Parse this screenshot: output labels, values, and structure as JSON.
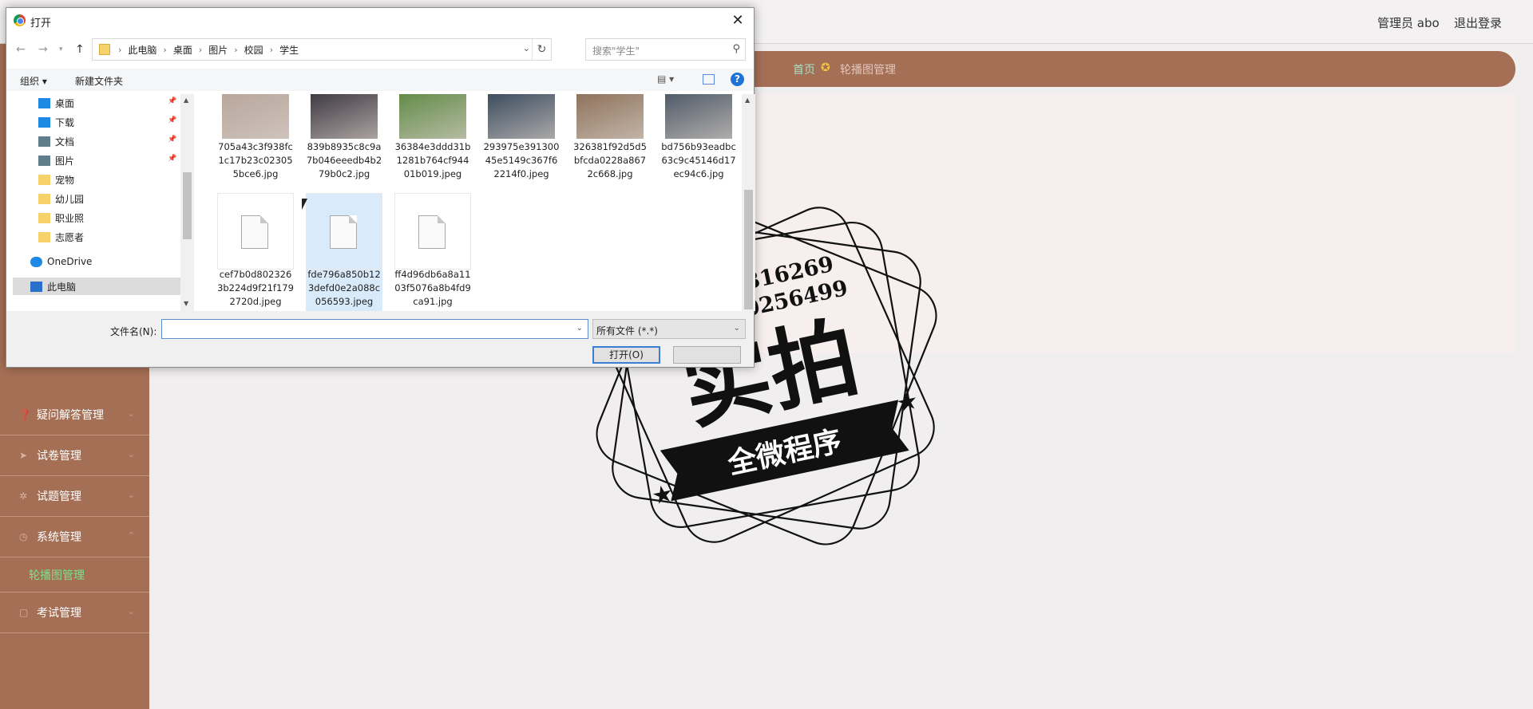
{
  "app": {
    "user_label": "管理员 abo",
    "logout_label": "退出登录",
    "breadcrumb_home": "首页",
    "breadcrumb_current": "轮播图管理",
    "sidebar": [
      {
        "label": "疑问解答管理"
      },
      {
        "label": "试卷管理"
      },
      {
        "label": "试题管理"
      },
      {
        "label": "系统管理"
      },
      {
        "label": "考试管理"
      }
    ],
    "sidebar_sub": "轮播图管理"
  },
  "stamp": {
    "line1": "Q2196316269",
    "line2": "V17060256499",
    "main": "实拍",
    "sub": "全微程序"
  },
  "dialog": {
    "title": "打开",
    "path": [
      "此电脑",
      "桌面",
      "图片",
      "校园",
      "学生"
    ],
    "search_placeholder": "搜索\"学生\"",
    "organize": "组织 ▾",
    "new_folder": "新建文件夹",
    "help": "?",
    "nav_items": [
      {
        "label": "桌面",
        "icon": "desktop-icon",
        "pinned": true,
        "color": "#1e88e5"
      },
      {
        "label": "下载",
        "icon": "download-icon",
        "pinned": true,
        "color": "#1e88e5"
      },
      {
        "label": "文档",
        "icon": "document-icon",
        "pinned": true,
        "color": "#607d8b"
      },
      {
        "label": "图片",
        "icon": "picture-icon",
        "pinned": true,
        "color": "#607d8b"
      },
      {
        "label": "宠物",
        "icon": "folder-icon",
        "pinned": false,
        "color": "#f7d26a"
      },
      {
        "label": "幼儿园",
        "icon": "folder-icon",
        "pinned": false,
        "color": "#f7d26a"
      },
      {
        "label": "职业照",
        "icon": "folder-icon",
        "pinned": false,
        "color": "#f7d26a"
      },
      {
        "label": "志愿者",
        "icon": "folder-icon",
        "pinned": false,
        "color": "#f7d26a"
      },
      {
        "label": "OneDrive",
        "icon": "cloud-icon",
        "pinned": false,
        "color": "#1e88e5"
      },
      {
        "label": "此电脑",
        "icon": "computer-icon",
        "pinned": false,
        "color": "#2a6fc9",
        "selected": true
      }
    ],
    "files_row1": [
      {
        "name": "705a43c3f938fc1c17b23c023055bce6.jpg",
        "tone": "#b7a59b"
      },
      {
        "name": "839b8935c8c9a7b046eeedb4b279b0c2.jpg",
        "tone": "#3b3640"
      },
      {
        "name": "36384e3ddd31b1281b764cf94401b019.jpeg",
        "tone": "#5f8a45"
      },
      {
        "name": "293975e39130045e5149c367f62214f0.jpeg",
        "tone": "#38495c"
      },
      {
        "name": "326381f92d5d5bfcda0228a8672c668.jpg",
        "tone": "#8c7058"
      },
      {
        "name": "bd756b93eadbc63c9c45146d17ec94c6.jpg",
        "tone": "#4c5866"
      }
    ],
    "files_row2": [
      {
        "name": "cef7b0d8023263b224d9f21f1792720d.jpeg"
      },
      {
        "name": "fde796a850b123defd0e2a088c056593.jpeg",
        "selected": true
      },
      {
        "name": "ff4d96db6a8a1103f5076a8b4fd9ca91.jpg"
      }
    ],
    "filename_label": "文件名(N):",
    "filename_value": "",
    "filetype": "所有文件 (*.*)",
    "open_label": "打开(O)"
  }
}
